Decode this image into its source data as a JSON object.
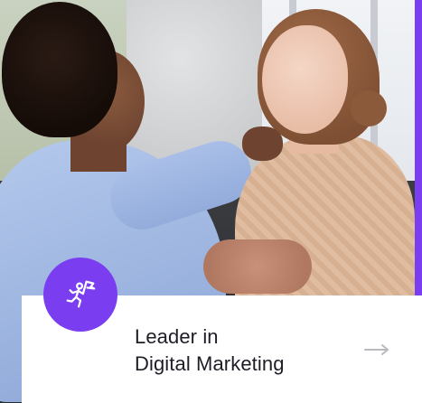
{
  "card": {
    "headline_line1": "Leader in",
    "headline_line2": "Digital Marketing",
    "badge_icon": "runner-flag-icon",
    "arrow_icon": "arrow-right-icon"
  },
  "colors": {
    "accent": "#7a3ef0",
    "text": "#1d1d26",
    "arrow": "#b9b9bf",
    "panel": "#ffffff"
  }
}
